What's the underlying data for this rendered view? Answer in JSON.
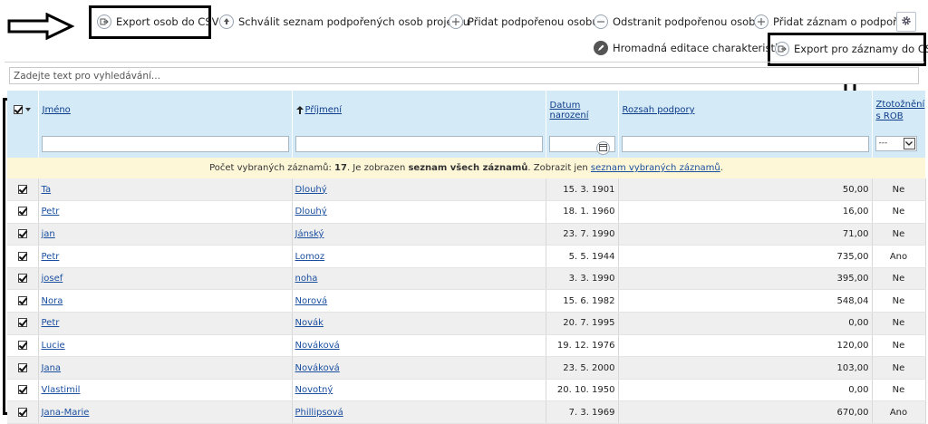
{
  "toolbar": {
    "export_csv": "Export osob do CSV",
    "approve_list": "Schválit seznam podpořených osob projektu",
    "add_person": "Přidat podpořenou osobu",
    "remove_person": "Odstranit podpořenou osobu",
    "add_record": "Přidat záznam o podpoře",
    "bulk_edit": "Hromadná editace charakteristik",
    "export_records": "Export pro záznamy do CSV",
    "settings_icon": "gear-icon"
  },
  "search": {
    "placeholder": "Zadejte text pro vyhledávání..."
  },
  "table": {
    "headers": {
      "name": "Jméno",
      "surname": "Příjmení",
      "birth": "Datum narození",
      "support": "Rozsah podpory",
      "rob_line1": "Ztotožnění",
      "rob_line2": "s ROB"
    },
    "rob_filter_value": "---",
    "info": {
      "prefix": "Počet vybraných záznamů: ",
      "count": "17",
      "middle": ". Je zobrazen ",
      "shown": "seznam všech záznamů",
      "after": ". Zobrazit jen ",
      "link": "seznam vybraných záznamů",
      "end": "."
    },
    "rows": [
      {
        "name": "Ta",
        "surname": "Dlouhý",
        "birth": "15. 3. 1901",
        "support": "50,00",
        "rob": "Ne"
      },
      {
        "name": "Petr",
        "surname": "Dlouhý",
        "birth": "18. 1. 1960",
        "support": "16,00",
        "rob": "Ne"
      },
      {
        "name": "jan",
        "surname": "Jánský",
        "birth": "23. 7. 1990",
        "support": "71,00",
        "rob": "Ne"
      },
      {
        "name": "Petr",
        "surname": "Lomoz",
        "birth": "5. 5. 1944",
        "support": "735,00",
        "rob": "Ano"
      },
      {
        "name": "josef",
        "surname": "noha",
        "birth": "3. 3. 1990",
        "support": "395,00",
        "rob": "Ne"
      },
      {
        "name": "Nora",
        "surname": "Norová",
        "birth": "15. 6. 1982",
        "support": "548,04",
        "rob": "Ne"
      },
      {
        "name": "Petr",
        "surname": "Novák",
        "birth": "20. 7. 1995",
        "support": "0,00",
        "rob": "Ne"
      },
      {
        "name": "Lucie",
        "surname": "Nováková",
        "birth": "19. 12. 1976",
        "support": "120,00",
        "rob": "Ne"
      },
      {
        "name": "Jana",
        "surname": "Nováková",
        "birth": "23. 5. 2000",
        "support": "103,00",
        "rob": "Ne"
      },
      {
        "name": "Vlastimil",
        "surname": "Novotný",
        "birth": "20. 10. 1950",
        "support": "0,00",
        "rob": "Ne"
      },
      {
        "name": "Jana-Marie",
        "surname": "Phillipsová",
        "birth": "7. 3. 1969",
        "support": "670,00",
        "rob": "Ano"
      }
    ]
  },
  "colors": {
    "header_bg": "#d5eaf7",
    "info_bg": "#fdf7d8",
    "link": "#1a4fa0"
  }
}
